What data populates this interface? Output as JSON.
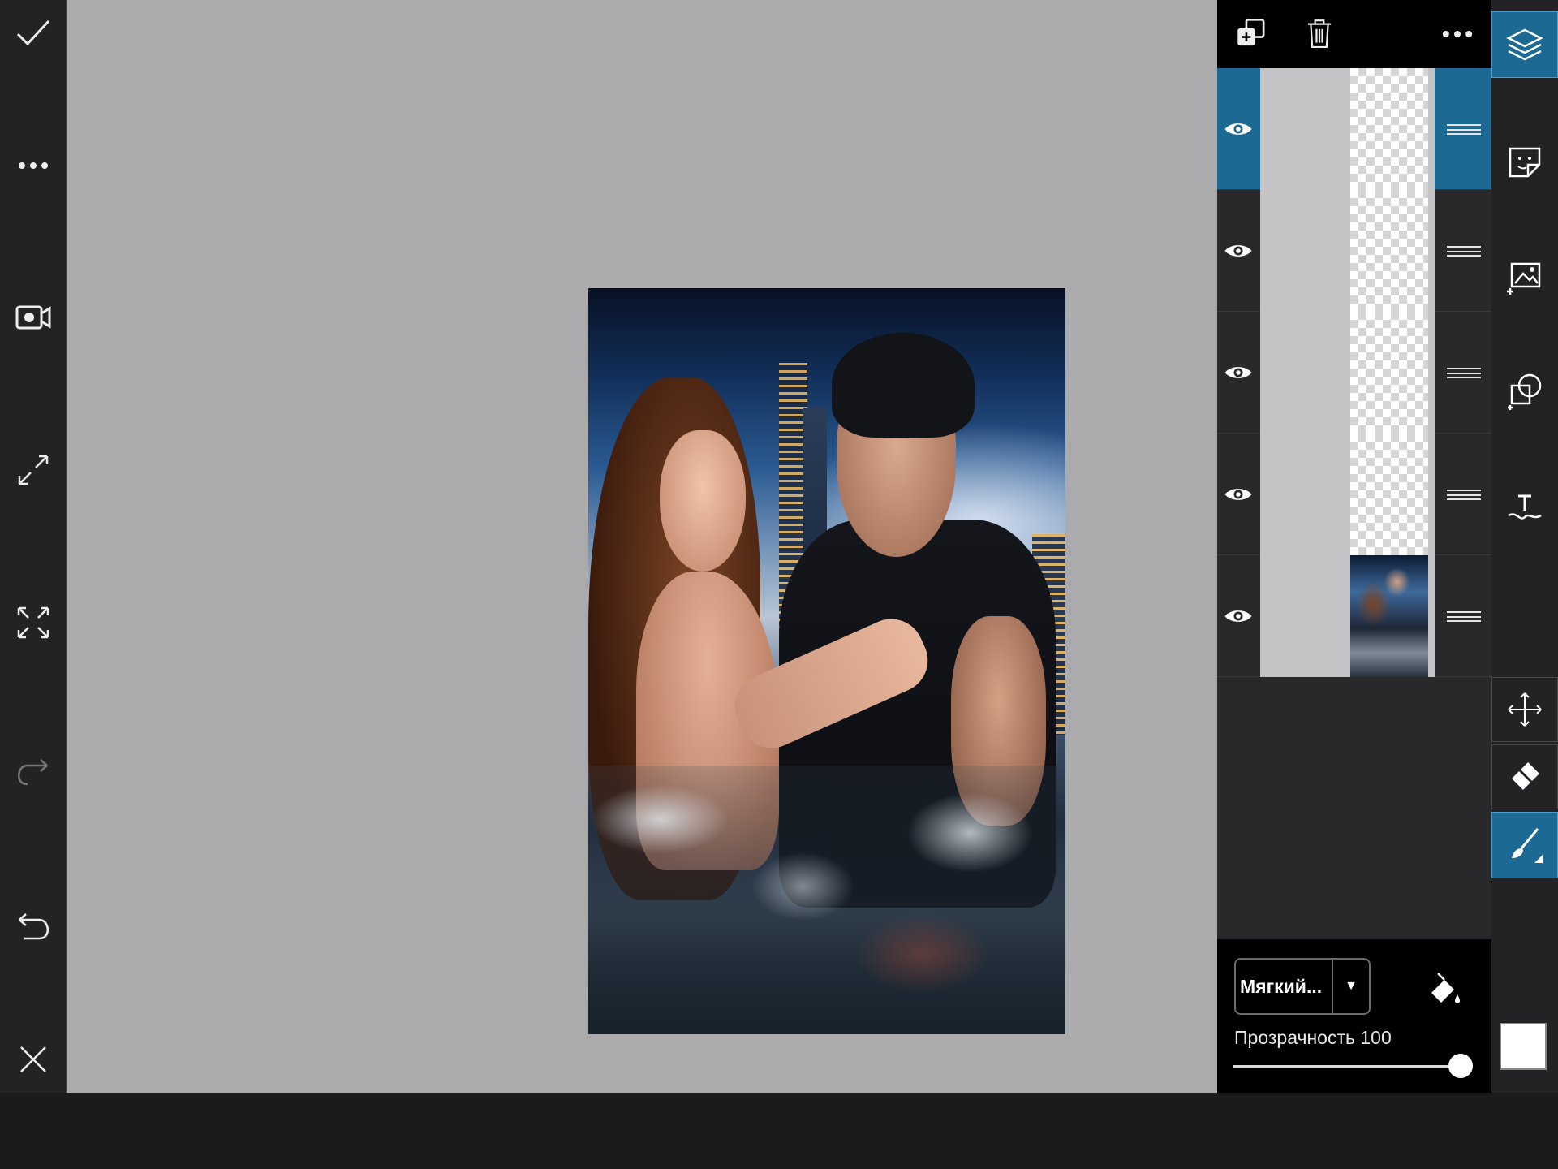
{
  "left_toolbar": {
    "items": [
      "confirm",
      "more",
      "record",
      "resize",
      "fit",
      "redo",
      "undo",
      "close"
    ]
  },
  "layers_toolbar": {
    "actions": [
      "add-layer",
      "delete-layer",
      "more"
    ]
  },
  "layers": [
    {
      "id": 1,
      "visible": true,
      "selected": true,
      "kind": "transparent"
    },
    {
      "id": 2,
      "visible": true,
      "selected": false,
      "kind": "transparent"
    },
    {
      "id": 3,
      "visible": true,
      "selected": false,
      "kind": "transparent"
    },
    {
      "id": 4,
      "visible": true,
      "selected": false,
      "kind": "transparent"
    },
    {
      "id": 5,
      "visible": true,
      "selected": false,
      "kind": "photo"
    }
  ],
  "brush_panel": {
    "brush_name": "Мягкий...",
    "dropdown_arrow": "▼",
    "opacity_label": "Прозрачность 100",
    "opacity_value": 100
  },
  "right_tools": {
    "items": [
      "layers",
      "sticker",
      "add-image",
      "shape-crop",
      "text",
      "move",
      "eraser",
      "brush"
    ],
    "active": [
      "layers",
      "brush"
    ]
  },
  "colors": {
    "accent": "#1c6a93",
    "canvas": "#abaaad",
    "panel": "#29292c",
    "current_color": "#ffffff"
  }
}
